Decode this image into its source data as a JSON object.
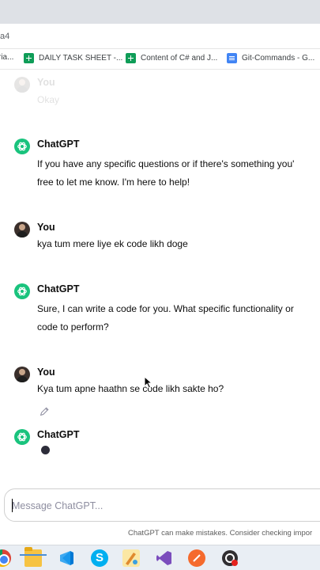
{
  "browser": {
    "url_fragment": "a4",
    "bookmarks": [
      {
        "label": "ria...",
        "icon": "bookmark-icon"
      },
      {
        "label": "DAILY TASK SHEET -...",
        "icon": "google-sheets-icon"
      },
      {
        "label": "Content of C# and J...",
        "icon": "google-sheets-icon"
      },
      {
        "label": "Git-Commands - G...",
        "icon": "google-docs-icon"
      }
    ]
  },
  "chat": {
    "messages": [
      {
        "author": "You",
        "lines": [
          "Okay"
        ]
      },
      {
        "author": "ChatGPT",
        "lines": [
          "If you have any specific questions or if there's something you'",
          "free to let me know. I'm here to help!"
        ]
      },
      {
        "author": "You",
        "lines": [
          "kya tum mere liye ek code likh doge"
        ]
      },
      {
        "author": "ChatGPT",
        "lines": [
          "Sure, I can write a code for you. What specific functionality or",
          "code to perform?"
        ]
      },
      {
        "author": "You",
        "lines": [
          "Kya tum apne haathn se code likh sakte ho?"
        ]
      },
      {
        "author": "ChatGPT",
        "lines": []
      }
    ]
  },
  "composer": {
    "placeholder": "Message ChatGPT..."
  },
  "disclaimer": "ChatGPT can make mistakes. Consider checking impor",
  "colors": {
    "chatgpt_green": "#19c37d",
    "tab_strip": "#dee1e6",
    "taskbar": "#e9eef4"
  }
}
